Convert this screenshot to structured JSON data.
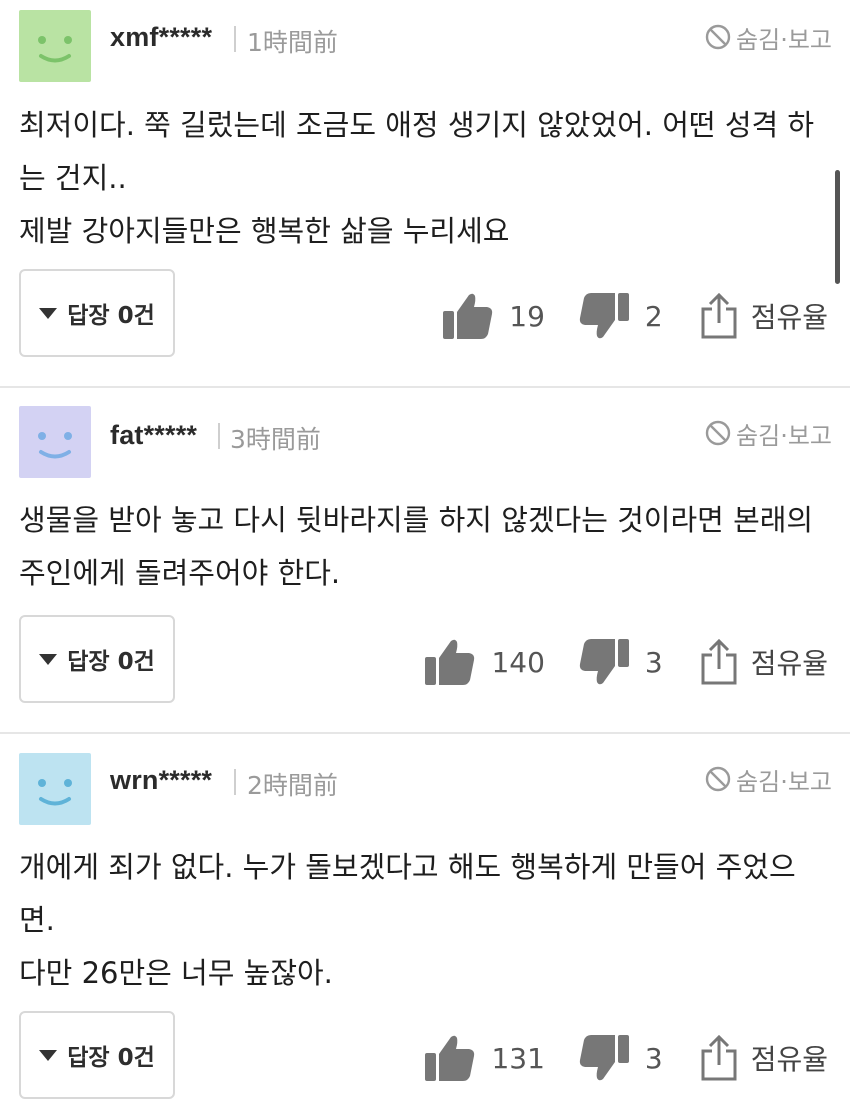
{
  "comments": [
    {
      "username": "xmf*****",
      "time": "1時間前",
      "hide_report": "숨김·보고",
      "body": "최저이다. 쭉 길렀는데 조금도 애정 생기지 않았었어. 어떤 성격 하는 건지..\n제발 강아지들만은 행복한 삶을 누리세요",
      "reply_label": "답장 0건",
      "likes": "19",
      "dislikes": "2",
      "share_label": "점유율",
      "avatar_color": "#b9e3a3",
      "avatar_face_color": "#7cc36a"
    },
    {
      "username": "fat*****",
      "time": "3時間前",
      "hide_report": "숨김·보고",
      "body": "생물을 받아 놓고 다시 뒷바라지를 하지 않겠다는 것이라면 본래의 주인에게 돌려주어야 한다.",
      "reply_label": "답장 0건",
      "likes": "140",
      "dislikes": "3",
      "share_label": "점유율",
      "avatar_color": "#d3d2f3",
      "avatar_face_color": "#7fb0e6"
    },
    {
      "username": "wrn*****",
      "time": "2時間前",
      "hide_report": "숨김·보고",
      "body": "개에게 죄가 없다. 누가 돌보겠다고 해도 행복하게 만들어 주었으면.\n다만 26만은 너무 높잖아.",
      "reply_label": "답장 0건",
      "likes": "131",
      "dislikes": "3",
      "share_label": "점유율",
      "avatar_color": "#bde3f1",
      "avatar_face_color": "#5fb3d8"
    }
  ]
}
